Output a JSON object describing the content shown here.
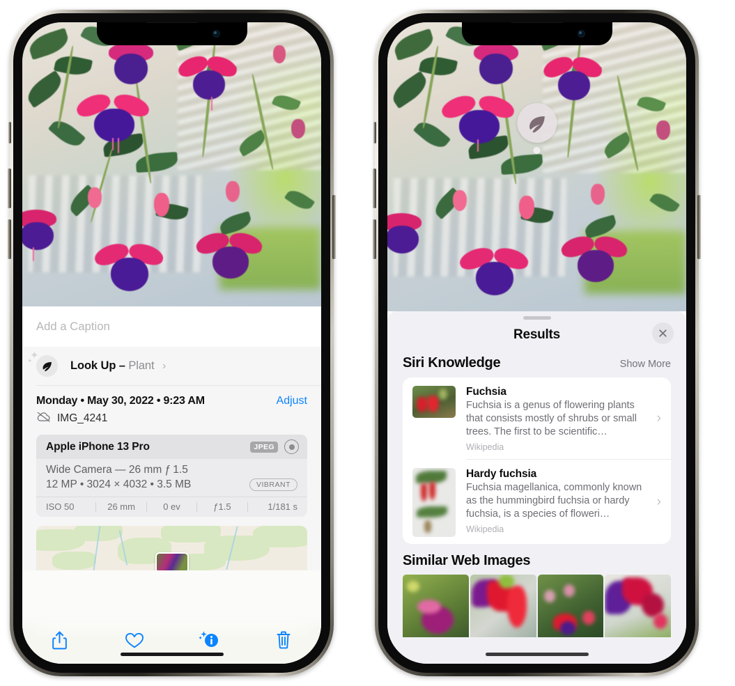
{
  "left_phone": {
    "name": "Photos app — photo info view",
    "caption": {
      "placeholder": "Add a Caption",
      "value": ""
    },
    "look_up": {
      "label": "Look Up",
      "dash": "–",
      "subject": "Plant",
      "chevron": "›",
      "icon": "leaf-icon"
    },
    "metadata": {
      "date_line": "Monday • May 30, 2022 • 9:23 AM",
      "adjust_label": "Adjust",
      "filename": "IMG_4241",
      "cloud_icon": "icloud-slash-icon"
    },
    "camera_card": {
      "model": "Apple iPhone 13 Pro",
      "format_badge": "JPEG",
      "lens_icon": "lens-icon",
      "lens_line": "Wide Camera — 26 mm ƒ 1.5",
      "specs_line": "12 MP • 3024 × 4032 • 3.5 MB",
      "style_badge": "VIBRANT",
      "exif": [
        "ISO 50",
        "26 mm",
        "0 ev",
        "ƒ1.5",
        "1/181 s"
      ]
    },
    "map": {
      "alt": "location map with photo pin"
    },
    "toolbar": [
      {
        "name": "share-button",
        "icon": "share-icon"
      },
      {
        "name": "favorite-button",
        "icon": "heart-icon"
      },
      {
        "name": "info-button",
        "icon": "info-sparkle-icon"
      },
      {
        "name": "delete-button",
        "icon": "trash-icon"
      }
    ]
  },
  "right_phone": {
    "name": "Visual Look Up results",
    "photo_badge": {
      "icon": "leaf-icon",
      "label": "plant-lookup-badge"
    },
    "sheet": {
      "title": "Results",
      "close_label": "×",
      "sections": [
        {
          "title": "Siri Knowledge",
          "action": "Show More",
          "items": [
            {
              "title": "Fuchsia",
              "description": "Fuchsia is a genus of flowering plants that consists mostly of shrubs or small trees. The first to be scientific…",
              "source": "Wikipedia",
              "chevron": "›"
            },
            {
              "title": "Hardy fuchsia",
              "description": "Fuchsia magellanica, commonly known as the hummingbird fuchsia or hardy fuchsia, is a species of floweri…",
              "source": "Wikipedia",
              "chevron": "›"
            }
          ]
        },
        {
          "title": "Similar Web Images",
          "images": [
            "web-image-1",
            "web-image-2",
            "web-image-3",
            "web-image-4"
          ]
        }
      ]
    }
  },
  "colors": {
    "accent_blue": "#0b84fe",
    "sheet_gray": "#f1f1f5",
    "card_white": "#ffffff",
    "secondary_text": "#6e6e75",
    "tertiary_text": "#aeaeb4"
  }
}
